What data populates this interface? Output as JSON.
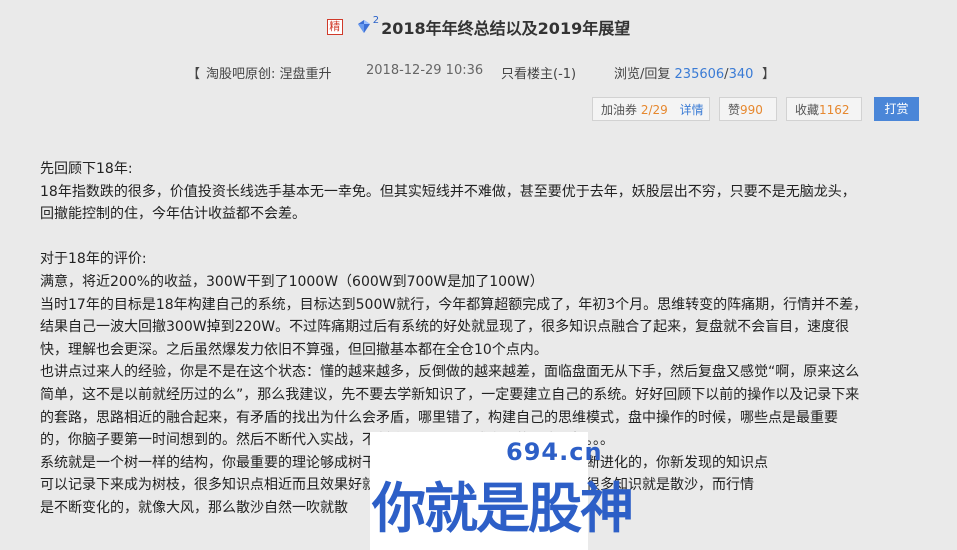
{
  "post": {
    "badge": "精",
    "level_sup": "2",
    "title": "2018年年终总结以及2019年展望"
  },
  "meta": {
    "bracket_left": "【",
    "author": "淘股吧原创:  涅盘重升",
    "datetime": "2018-12-29 10:36",
    "only_op": "只看楼主(-1)",
    "views_label": "浏览/回复",
    "views": "235606",
    "slash": "/",
    "replies": "340",
    "bracket_right": "】"
  },
  "actions": {
    "coupon_label": "加油券",
    "coupon_value": "2/29",
    "detail_link": "详情",
    "like_label": "赞",
    "like_count": "990",
    "fav_label": "收藏",
    "fav_count": "1162",
    "tip_label": "打赏"
  },
  "content": {
    "lines": [
      "先回顾下18年:",
      "18年指数跌的很多，价值投资长线选手基本无一幸免。但其实短线并不难做，甚至要优于去年，妖股层出不穷，只要不是无脑龙头，",
      "回撤能控制的住，今年估计收益都不会差。",
      "",
      "对于18年的评价:",
      "满意，将近200%的收益，300W干到了1000W（600W到700W是加了100W）",
      "当时17年的目标是18年构建自己的系统，目标达到500W就行，今年都算超额完成了，年初3个月。思维转变的阵痛期，行情并不差，",
      "结果自己一波大回撤300W掉到220W。不过阵痛期过后有系统的好处就显现了，很多知识点融合了起来，复盘就不会盲目，速度很",
      "快，理解也会更深。之后虽然爆发力依旧不算强，但回撤基本都在全仓10个点内。",
      "也讲点过来人的经验，你是不是在这个状态：懂的越来越多，反倒做的越来越差，面临盘面无从下手，然后复盘又感觉“啊，原来这么",
      "简单，这不是以前就经历过的么”，那么我建议，先不要去学新知识了，一定要建立自己的系统。好好回顾下以前的操作以及记录下来",
      "的套路，思路相近的融合起来，有矛盾的找出为什么会矛盾，哪里错了，构建自己的思维模式，盘中操作的时候，哪些点是最重要",
      "的，你脑子要第一时间想到的。然后不断代入实战，不断修正，最后形成自己的肌肉记忆。。。",
      "系统就是一个树一样的结构，你最重要的理论够成树干，然后是分支，这个系统是可以不断进化的，你新发现的知识点",
      "可以记录下来成为树枝，很多知识点相近而且效果好就会成为树干，如果你没有系统，你很多知识就是散沙，而行情",
      "是不断变化的，就像大风，那么散沙自然一吹就散"
    ]
  },
  "watermark": {
    "site": "694.cn",
    "slogan": "你就是股神"
  }
}
